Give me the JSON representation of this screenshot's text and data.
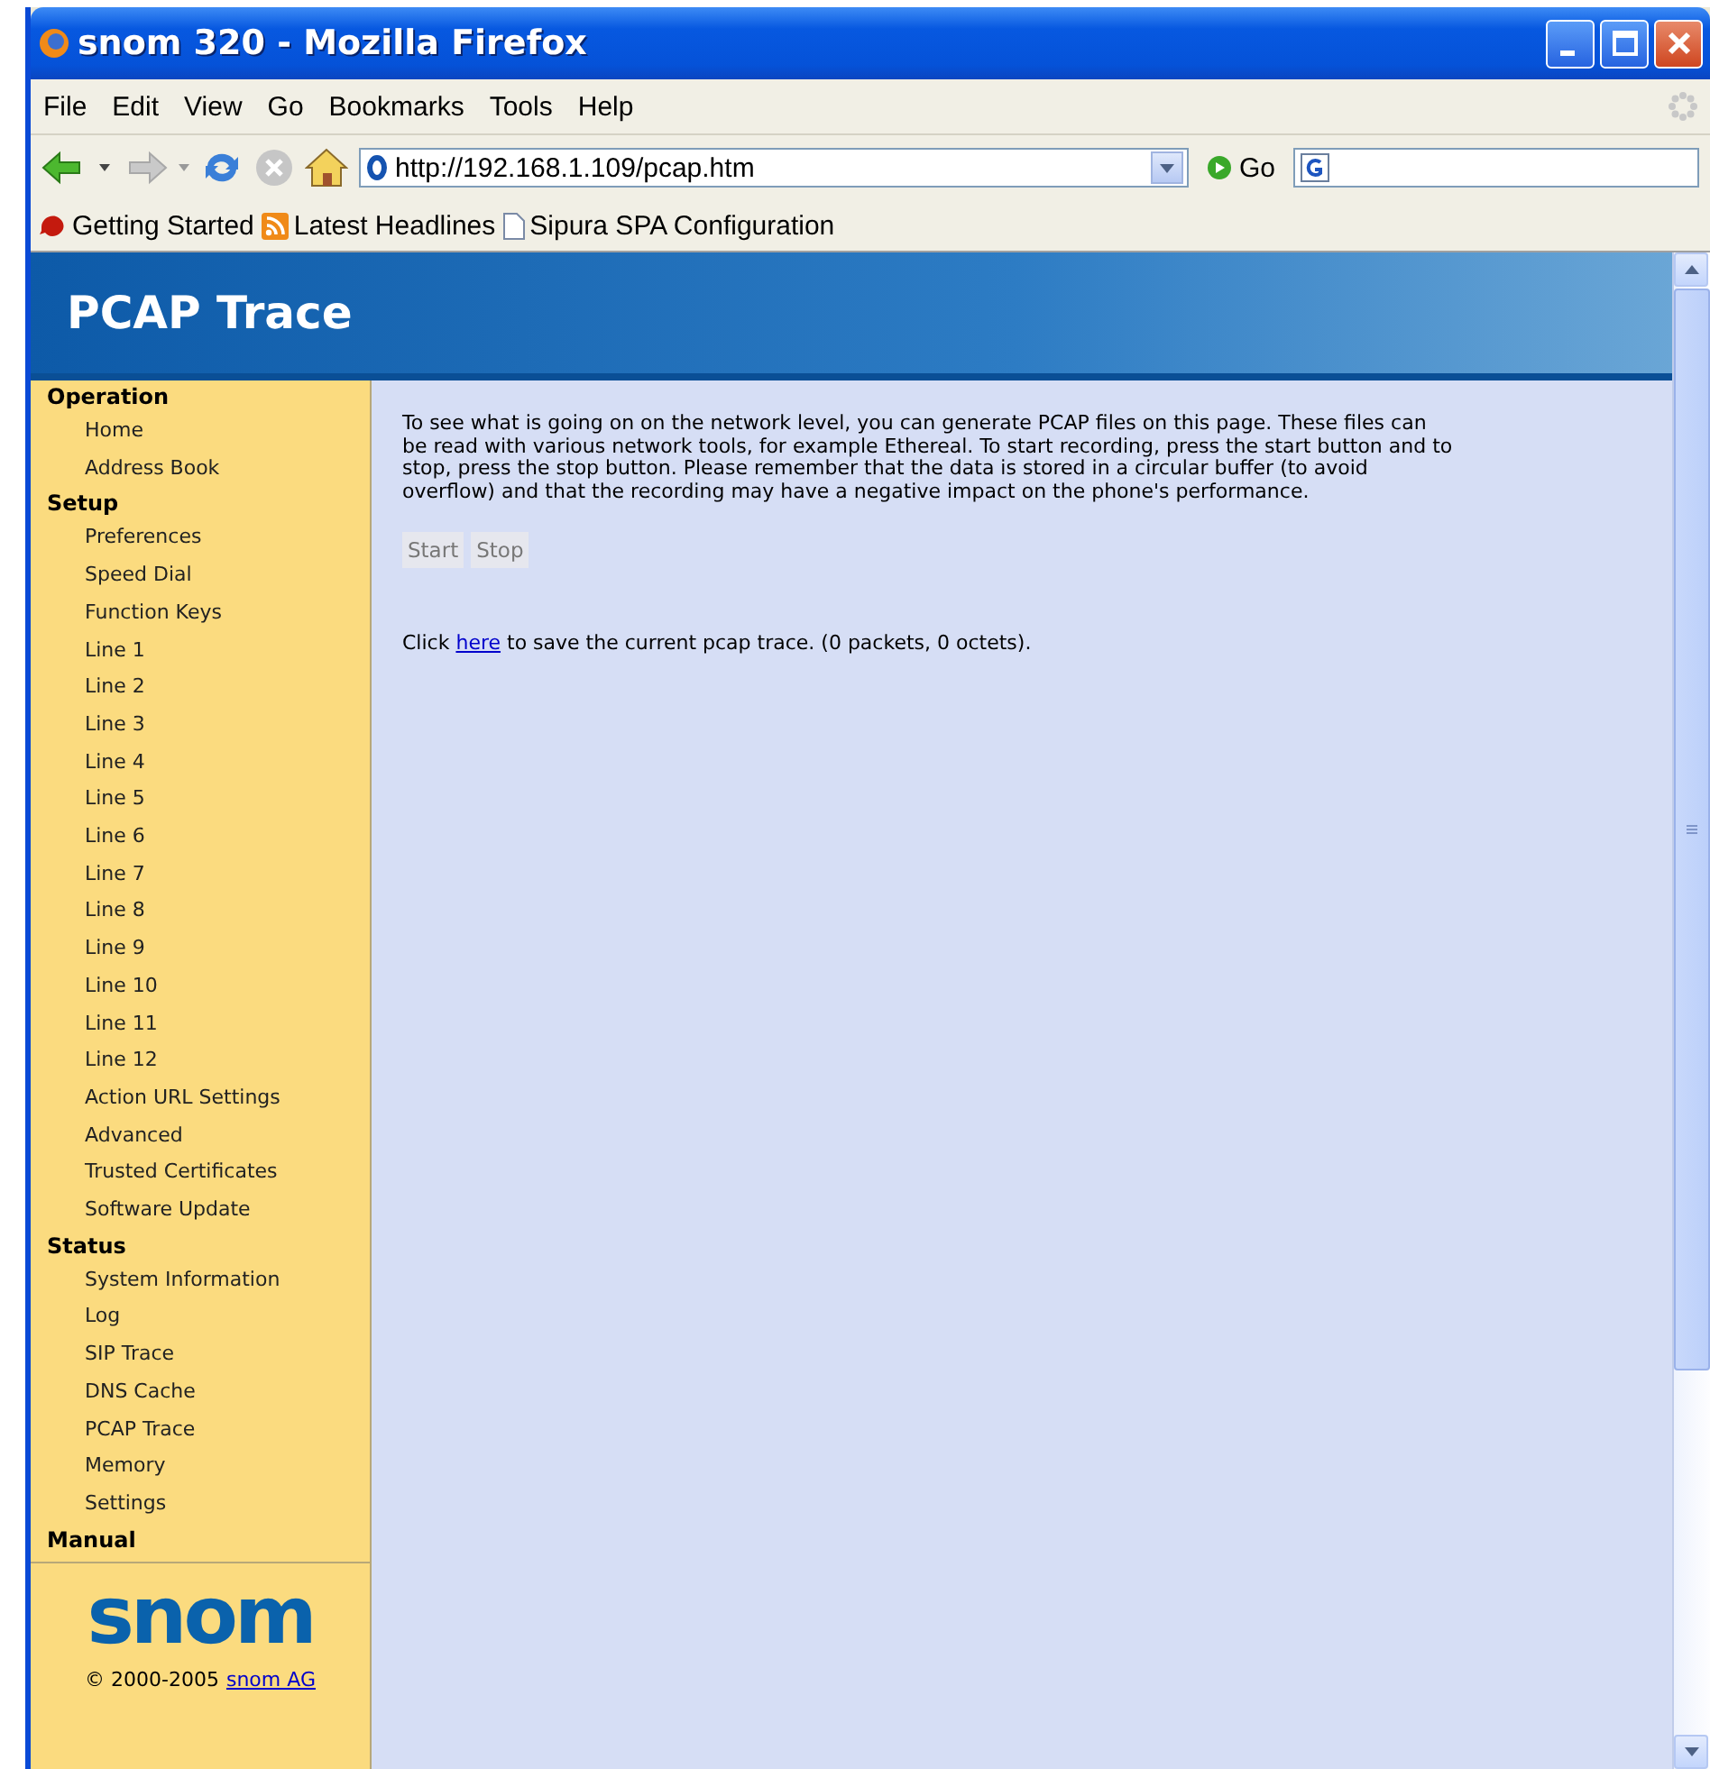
{
  "window": {
    "title": "snom 320 - Mozilla Firefox"
  },
  "menu": [
    "File",
    "Edit",
    "View",
    "Go",
    "Bookmarks",
    "Tools",
    "Help"
  ],
  "address_bar": {
    "url": "http://192.168.1.109/pcap.htm",
    "go_label": "Go"
  },
  "bookmarks": [
    {
      "label": "Getting Started",
      "kind": "firefox"
    },
    {
      "label": "Latest Headlines",
      "kind": "feed"
    },
    {
      "label": "Sipura SPA Configuration",
      "kind": "page"
    }
  ],
  "page": {
    "heading": "PCAP Trace",
    "sidebar": [
      {
        "label": "Operation",
        "children": [
          {
            "label": "Home"
          },
          {
            "label": "Address Book"
          }
        ]
      },
      {
        "label": "Setup",
        "children": [
          {
            "label": "Preferences"
          },
          {
            "label": "Speed Dial"
          },
          {
            "label": "Function Keys"
          },
          {
            "label": "Line 1"
          },
          {
            "label": "Line 2"
          },
          {
            "label": "Line 3"
          },
          {
            "label": "Line 4"
          },
          {
            "label": "Line 5"
          },
          {
            "label": "Line 6"
          },
          {
            "label": "Line 7"
          },
          {
            "label": "Line 8"
          },
          {
            "label": "Line 9"
          },
          {
            "label": "Line 10"
          },
          {
            "label": "Line 11"
          },
          {
            "label": "Line 12"
          },
          {
            "label": "Action URL Settings"
          },
          {
            "label": "Advanced"
          },
          {
            "label": "Trusted Certificates"
          },
          {
            "label": "Software Update"
          }
        ]
      },
      {
        "label": "Status",
        "children": [
          {
            "label": "System Information"
          },
          {
            "label": "Log"
          },
          {
            "label": "SIP Trace"
          },
          {
            "label": "DNS Cache"
          },
          {
            "label": "PCAP Trace"
          },
          {
            "label": "Memory"
          },
          {
            "label": "Settings"
          }
        ]
      },
      {
        "label": "Manual"
      }
    ],
    "logo": "snom",
    "copyright": "© 2000-2005",
    "copyright_link": "snom AG",
    "description": "To see what is going on on the network level, you can generate PCAP files on this page. These files can be read with various network tools, for example Ethereal. To start recording, press the start button and to stop, press the stop button. Please remember that the data is stored in a circular buffer (to avoid overflow) and that the recording may have a negative impact on the phone's performance.",
    "buttons": [
      {
        "label": "Start",
        "disabled": true
      },
      {
        "label": "Stop",
        "disabled": true
      }
    ],
    "save_line": {
      "before": "Click",
      "link": "here",
      "after": "to save the current pcap trace. (0 packets, 0 octets)."
    }
  }
}
